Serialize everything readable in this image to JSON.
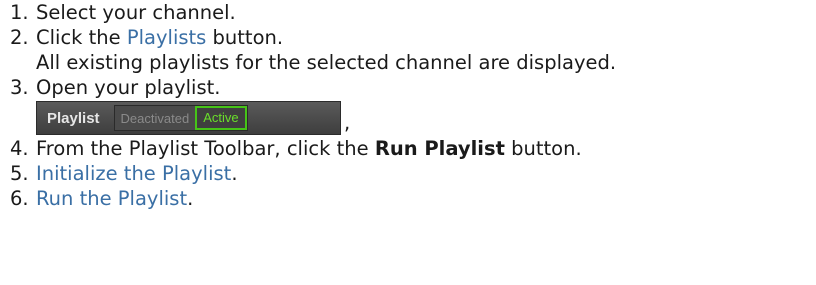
{
  "steps": [
    {
      "num": "1.",
      "text": "Select your channel."
    },
    {
      "num": "2.",
      "pre": "Click the ",
      "link": "Playlists",
      "post": " button."
    },
    {
      "sub": "All existing playlists for the selected channel are displayed."
    },
    {
      "num": "3.",
      "text": "Open your playlist."
    },
    {
      "num": "4.",
      "pre": "From the Playlist Toolbar, click the ",
      "bold": "Run Playlist",
      "post": " button."
    },
    {
      "num": "5.",
      "link": "Initialize the Playlist",
      "post": "."
    },
    {
      "num": "6.",
      "link": "Run the Playlist",
      "post": "."
    }
  ],
  "toolbar": {
    "label": "Playlist",
    "deactivated": "Deactivated",
    "active": "Active",
    "trailing": ","
  },
  "colors": {
    "link": "#3a6fa5",
    "active_green": "#46c418",
    "toolbar_bg": "#4a4a4a"
  }
}
